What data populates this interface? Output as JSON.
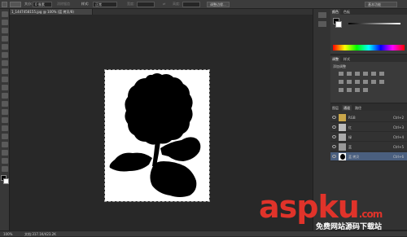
{
  "options_bar": {
    "size_label": "大小:",
    "feather_value": "0 像素",
    "antialias_label": "消除锯齿",
    "style_label": "样式:",
    "style_value": "正常",
    "width_label": "宽度:",
    "height_label": "高度:",
    "refine_edge_label": "调整边缘...",
    "workspace_value": "基本功能"
  },
  "document": {
    "tab_title": "1_1447458155.jpg @ 100% (蓝 拷贝/8)"
  },
  "status": {
    "zoom": "100%",
    "doc_info": "文档:317.1K/423.2K"
  },
  "color_panel": {
    "tabs": [
      "颜色",
      "色板"
    ]
  },
  "adjust_panel": {
    "tabs": [
      "调整",
      "样式"
    ],
    "add_label": "添加调整"
  },
  "channels_panel": {
    "tabs": [
      "图层",
      "通道",
      "路径"
    ],
    "rows": [
      {
        "name": "RGB",
        "key": "Ctrl+2",
        "selected": false
      },
      {
        "name": "红",
        "key": "Ctrl+3",
        "selected": false
      },
      {
        "name": "绿",
        "key": "Ctrl+4",
        "selected": false
      },
      {
        "name": "蓝",
        "key": "Ctrl+5",
        "selected": false
      },
      {
        "name": "蓝 拷贝",
        "key": "Ctrl+6",
        "selected": true
      }
    ]
  },
  "watermark": {
    "brand": "aspku",
    "suffix": ".com",
    "tagline": "免费网站源码下载站"
  },
  "colors": {
    "selection": "#4a5f7f",
    "watermark": "#e0332a"
  }
}
